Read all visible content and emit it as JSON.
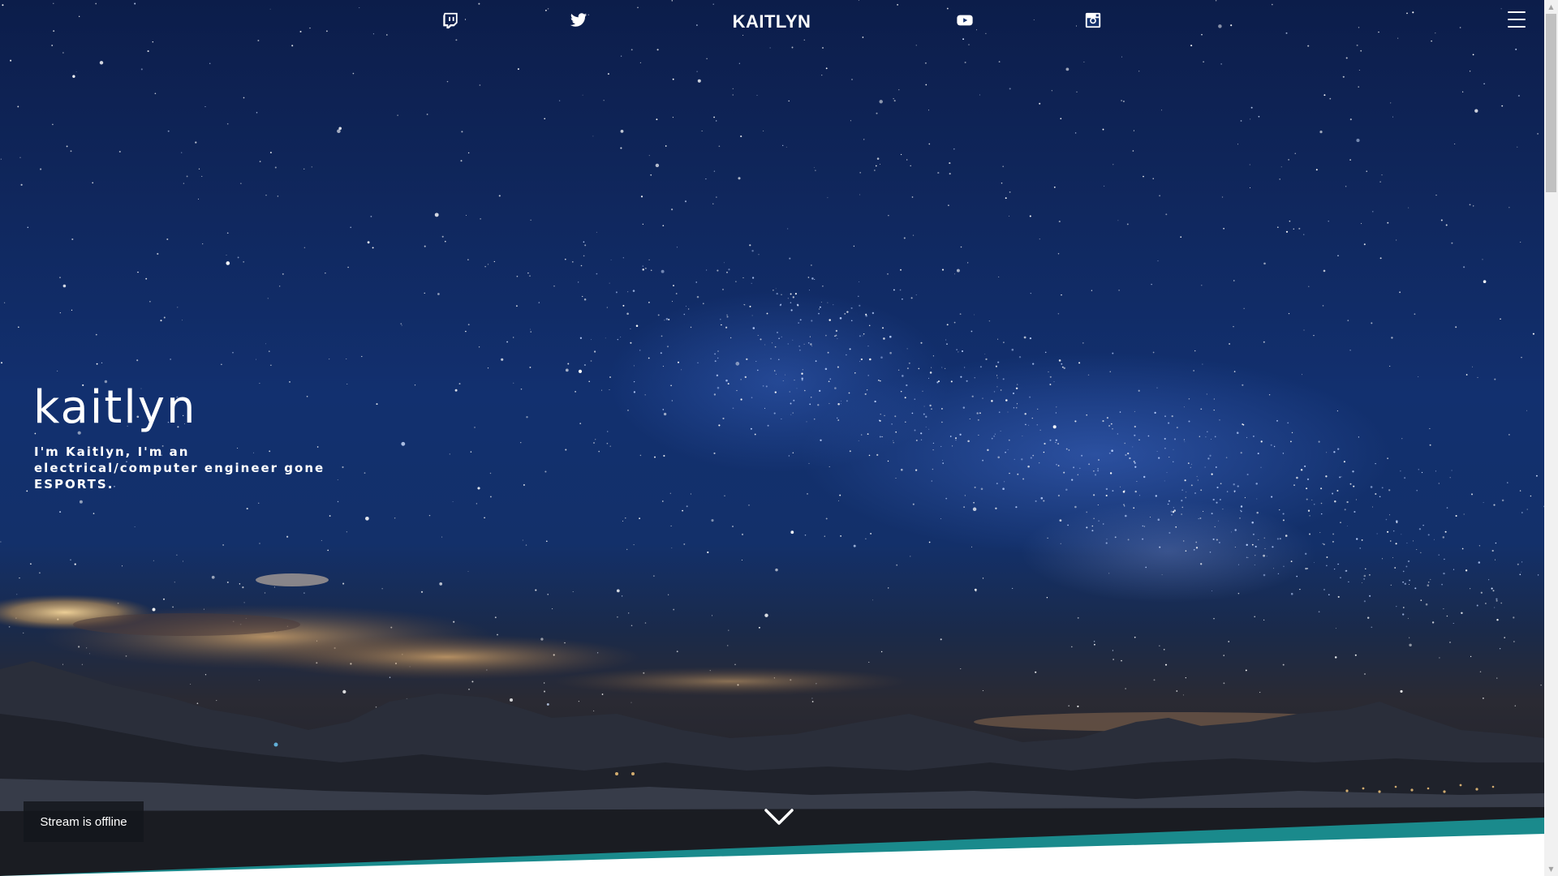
{
  "header": {
    "brand": "KAITLYN",
    "social": [
      {
        "name": "twitch",
        "icon": "twitch-icon"
      },
      {
        "name": "twitter",
        "icon": "twitter-icon"
      },
      {
        "name": "youtube",
        "icon": "youtube-icon"
      },
      {
        "name": "instagram",
        "icon": "instagram-icon"
      }
    ],
    "menu_icon": "hamburger-menu-icon"
  },
  "hero": {
    "title": "kaitlyn",
    "subtitle": "I'm Kaitlyn, I'm an electrical/computer engineer gone ESPORTS.",
    "scroll_icon": "chevron-down-icon",
    "background": "night-sky-milky-way-over-mountains"
  },
  "stream": {
    "status": "Stream is offline"
  },
  "colors": {
    "accent_teal": "#1a8a8c",
    "text": "#ffffff",
    "sky_dark": "#0c1d4a",
    "sky_mid": "#12306f"
  }
}
